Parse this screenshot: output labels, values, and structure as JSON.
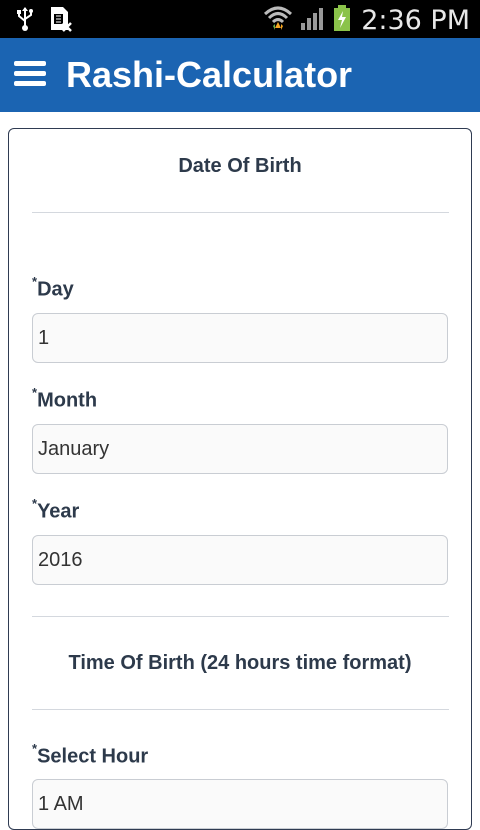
{
  "status_bar": {
    "time": "2:36 PM",
    "icons": [
      "usb-icon",
      "sim-icon",
      "wifi-icon",
      "signal-icon",
      "battery-charging-icon"
    ]
  },
  "app_bar": {
    "title": "Rashi-Calculator",
    "menu_icon": "hamburger-menu-icon",
    "background": "#1b64b2"
  },
  "form": {
    "date_section_title": "Date Of Birth",
    "required_mark": "*",
    "day": {
      "label": "Day",
      "value": "1"
    },
    "month": {
      "label": "Month",
      "value": "January"
    },
    "year": {
      "label": "Year",
      "value": "2016"
    },
    "time_section_title": "Time Of Birth (24 hours time format)",
    "hour": {
      "label": "Select Hour",
      "value": "1 AM"
    }
  }
}
